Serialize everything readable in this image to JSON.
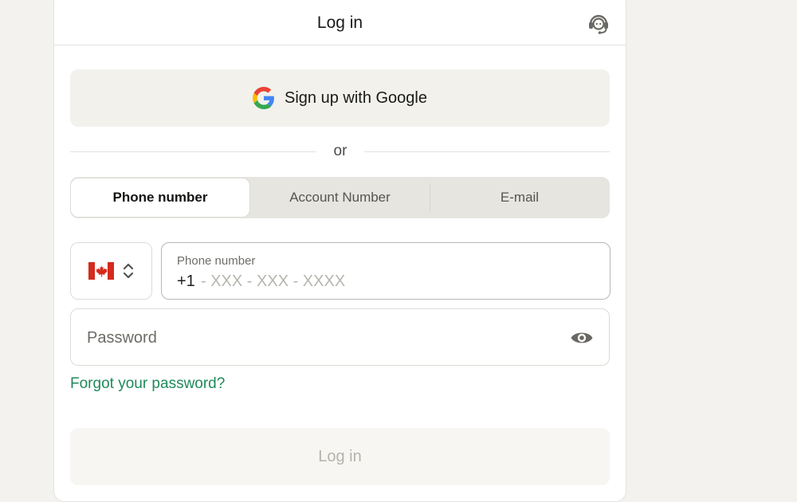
{
  "header": {
    "title": "Log in",
    "support_icon": "headset-support-icon"
  },
  "google_button": {
    "label": "Sign up with Google",
    "icon": "google-logo-icon"
  },
  "divider": {
    "text": "or"
  },
  "method_tabs": [
    {
      "label": "Phone number",
      "active": true
    },
    {
      "label": "Account Number",
      "active": false
    },
    {
      "label": "E-mail",
      "active": false
    }
  ],
  "country_selector": {
    "flag_icon": "canada-flag-icon",
    "chevron_icon": "chevron-up-down-icon"
  },
  "phone_field": {
    "label": "Phone number",
    "prefix": "+1",
    "placeholder": "- XXX - XXX - XXXX",
    "value": ""
  },
  "password_field": {
    "placeholder": "Password",
    "value": "",
    "toggle_icon": "eye-icon"
  },
  "forgot_link": "Forgot your password?",
  "submit_button": {
    "label": "Log in",
    "enabled": false
  },
  "colors": {
    "page_background": "#f3f2ee",
    "card_background": "#ffffff",
    "accent_green": "#1e8a5a",
    "button_muted": "#f2f1ec",
    "tab_track": "#e6e5e0",
    "disabled_text": "#b4b3ac"
  }
}
